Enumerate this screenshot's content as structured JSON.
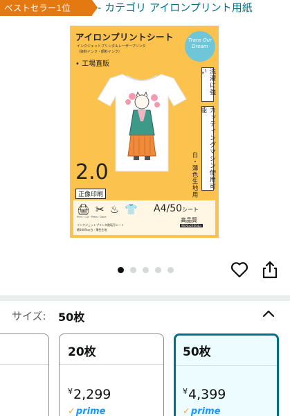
{
  "header": {
    "badge": "ベストセラー1位",
    "category": "- カテゴリ アイロンプリント用紙"
  },
  "product_image": {
    "title": "アイロンプリントシート",
    "subtitle_1": "インクジェットプリンタ＆レーザープリンタ",
    "subtitle_2": "（染料インク・顔料インク）",
    "badge_text": "Trans Our Dream",
    "factory": "• 工場直販",
    "label_wash": "洗濯に強い",
    "label_cutting": "カッティングマシン使用可能",
    "label_fabric": "白・薄色生地用",
    "version": "2.0",
    "mirror_print": "正像印刷",
    "steps": "Print · Cut · Press · Done",
    "size": "A4/50",
    "size_unit": "シート",
    "quality": "高品質",
    "dpi": "9600x2400dpi",
    "note_1": "インクジェットプリンタ熱転写シート",
    "note_2": "綿100%の白・薄色生地"
  },
  "carousel": {
    "count": 5,
    "active_index": 0
  },
  "actions": {
    "wishlist_icon": "heart-icon",
    "share_icon": "share-icon"
  },
  "size_selector": {
    "label": "サイズ:",
    "selected": "50枚",
    "options": [
      {
        "name": "",
        "price": "",
        "prime": ""
      },
      {
        "name": "20枚",
        "currency": "¥",
        "price": "2,299",
        "prime": "prime"
      },
      {
        "name": "50枚",
        "currency": "¥",
        "price": "4,399",
        "prime": "prime"
      }
    ]
  },
  "colors": {
    "bestseller": "#e47911",
    "link": "#007185",
    "prime": "#1a98ff",
    "selected_border": "#007185",
    "selected_bg": "#edfdff",
    "image_bg": "#fbc24e"
  }
}
